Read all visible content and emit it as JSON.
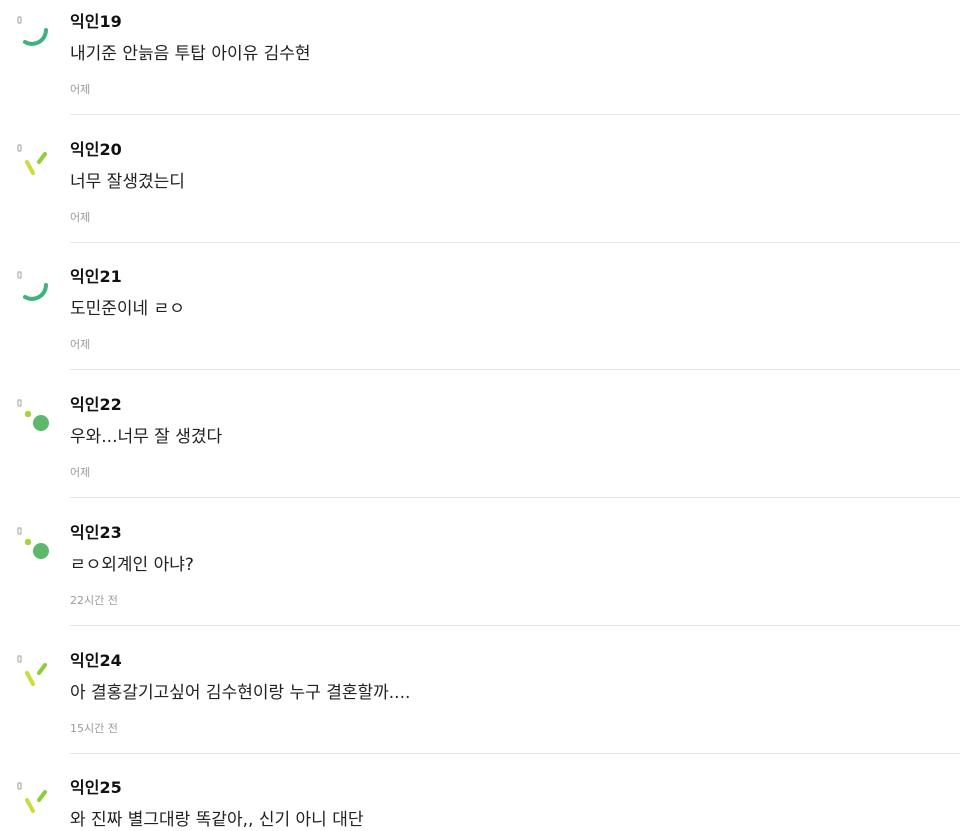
{
  "comments": [
    {
      "nickname": "익인19",
      "text": "내기준 안늙음 투탑 아이유 김수현",
      "time": "어제",
      "avatar_icon": "arc-icon"
    },
    {
      "nickname": "익인20",
      "text": "너무 잘생겼는디",
      "time": "어제",
      "avatar_icon": "sprout-icon"
    },
    {
      "nickname": "익인21",
      "text": "도민준이네 ㄹㅇ",
      "time": "어제",
      "avatar_icon": "arc-icon"
    },
    {
      "nickname": "익인22",
      "text": "우와...너무 잘 생겼다",
      "time": "어제",
      "avatar_icon": "dots-icon"
    },
    {
      "nickname": "익인23",
      "text": "ㄹㅇ외계인 아냐?",
      "time": "22시간 전",
      "avatar_icon": "dots-icon"
    },
    {
      "nickname": "익인24",
      "text": "아 결홍갈기고싶어 김수현이랑 누구 결혼할까....",
      "time": "15시간 전",
      "avatar_icon": "sprout-icon"
    },
    {
      "nickname": "익인25",
      "text": "와 진짜 별그대랑 똑같아,, 신기 아니 대단",
      "time": "",
      "avatar_icon": "sprout-icon"
    }
  ],
  "colors": {
    "arc_green": "#3fb27f",
    "sprout_lime": "#c9dd3c",
    "sprout_green": "#8ccf3a",
    "dot_lime": "#a6d43c",
    "dot_green": "#5cb86b",
    "marker_gray": "#b8b8b8"
  }
}
